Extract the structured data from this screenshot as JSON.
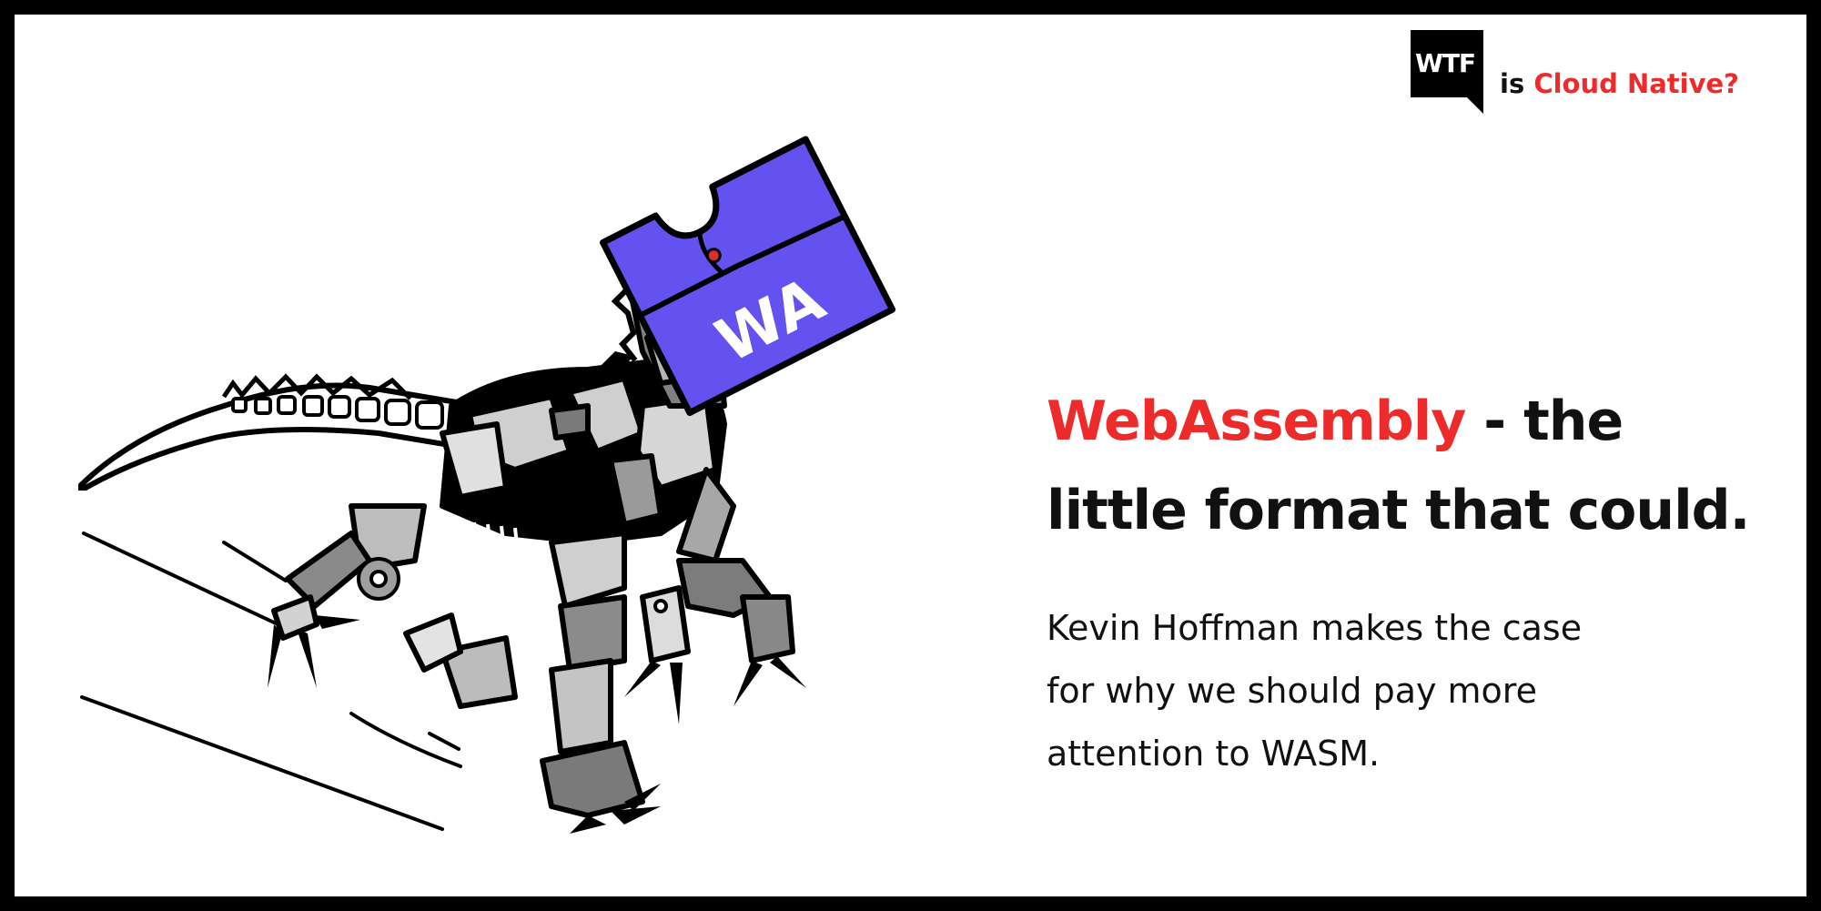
{
  "brand": {
    "badge_text": "WTF",
    "prefix": "is",
    "accent_text": "Cloud Native?",
    "accent_color": "#ee2b2b"
  },
  "illustration": {
    "subject": "robot-dinosaur",
    "logo_text": "WA",
    "logo_color": "#6352ef"
  },
  "headline": {
    "accent": "WebAssembly",
    "rest_line1": " - the",
    "line2": "little format that could."
  },
  "subtitle": {
    "line1": "Kevin Hoffman makes the case",
    "line2": "for why we should pay more",
    "line3": "attention to WASM."
  }
}
